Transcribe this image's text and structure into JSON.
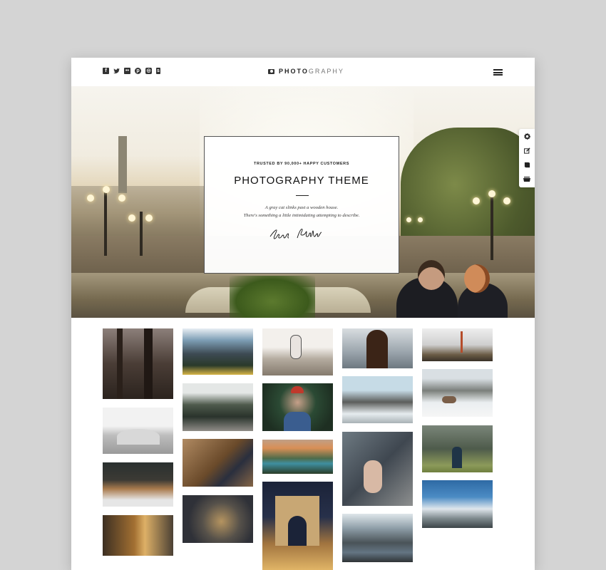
{
  "header": {
    "social_icons": [
      "facebook-icon",
      "twitter-icon",
      "flickr-icon",
      "pinterest-icon",
      "instagram-icon",
      "foursquare-icon"
    ],
    "brand_bold": "PHOTO",
    "brand_rest": "GRAPHY",
    "menu_icon": "hamburger-menu-icon"
  },
  "hero": {
    "kicker": "TRUSTED BY 90,000+ HAPPY CUSTOMERS",
    "title": "PHOTOGRAPHY THEME",
    "line1": "A gray cat slinks past a wooden house.",
    "line2": "There's something a little intimidating attempting to describe.",
    "signature": "John Phillips"
  },
  "side_tools": [
    "gear-icon",
    "edit-icon",
    "book-icon",
    "basket-icon"
  ],
  "gallery": {
    "columns": [
      [
        "misty forest",
        "skatepark",
        "log pile",
        "person on forest road"
      ],
      [
        "mountain lake",
        "forest road",
        "woman sitting",
        "hands with flowers"
      ],
      [
        "woman running",
        "red hat photographer",
        "lake sunset",
        "arc de triomphe"
      ],
      [
        "woman with wind hair",
        "snowy burnt trees",
        "hand on rainy glass",
        "river valley"
      ],
      [
        "golden gate bridge",
        "snow with deer",
        "person in forest",
        "cloudy peak"
      ]
    ]
  }
}
